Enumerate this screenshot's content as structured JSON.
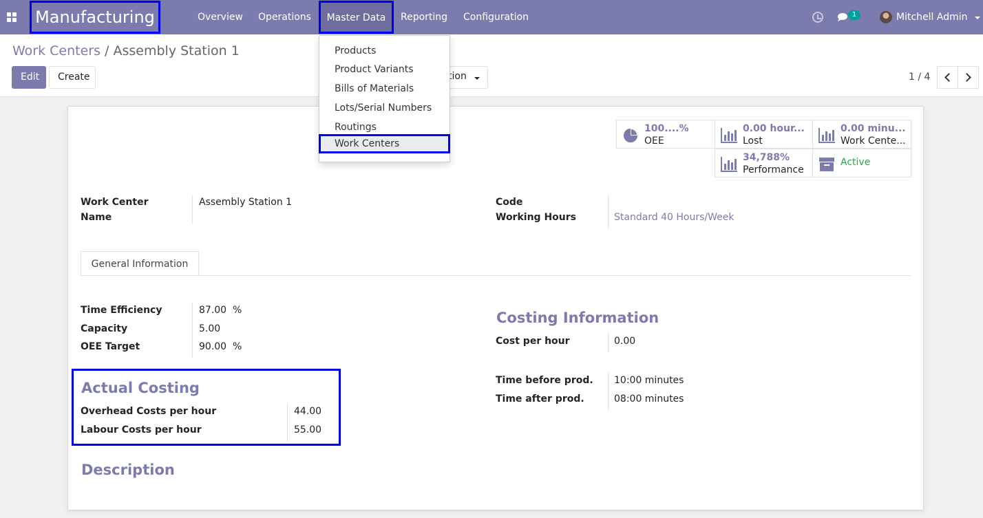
{
  "nav": {
    "brand": "Manufacturing",
    "menus": [
      "Overview",
      "Operations",
      "Master Data",
      "Reporting",
      "Configuration"
    ],
    "chat_badge": "1",
    "user": "Mitchell Admin"
  },
  "breadcrumb": {
    "parent": "Work Centers",
    "sep": "/",
    "current": "Assembly Station 1"
  },
  "toolbar": {
    "edit": "Edit",
    "create": "Create",
    "action": "tion"
  },
  "pager": {
    "value": "1 / 4"
  },
  "dropdown": {
    "items": [
      "Products",
      "Product Variants",
      "Bills of Materials",
      "Lots/Serial Numbers",
      "Routings",
      "Work Centers"
    ]
  },
  "stats": {
    "oee_value": "100....%",
    "oee_label": "OEE",
    "lost_value": "0.00 hour...",
    "lost_label": "Lost",
    "load_value": "0.00 minu...",
    "load_label": "Work Cente...",
    "perf_value": "34,788%",
    "perf_label": "Performance",
    "active_label": "Active"
  },
  "form": {
    "name_label_1": "Work Center",
    "name_label_2": "Name",
    "name_value": "Assembly Station 1",
    "code_label": "Code",
    "hours_label": "Working Hours",
    "hours_value": "Standard 40 Hours/Week",
    "tab": "General Information",
    "eff_label": "Time Efficiency",
    "eff_value": "87.00",
    "eff_unit": "%",
    "cap_label": "Capacity",
    "cap_value": "5.00",
    "oee_label": "OEE Target",
    "oee_value": "90.00",
    "oee_unit": "%",
    "costing_title": "Costing Information",
    "cph_label": "Cost per hour",
    "cph_value": "0.00",
    "tbp_label": "Time before prod.",
    "tbp_value": "10:00 minutes",
    "tap_label": "Time after prod.",
    "tap_value": "08:00 minutes",
    "actual_title": "Actual Costing",
    "overhead_label": "Overhead Costs per hour",
    "overhead_value": "44.00",
    "labour_label": "Labour Costs per hour",
    "labour_value": "55.00",
    "desc_title": "Description"
  },
  "colors": {
    "brand": "#7c7bad",
    "highlight": "#0000ee",
    "active": "#28a745",
    "badge": "#00a09d"
  }
}
